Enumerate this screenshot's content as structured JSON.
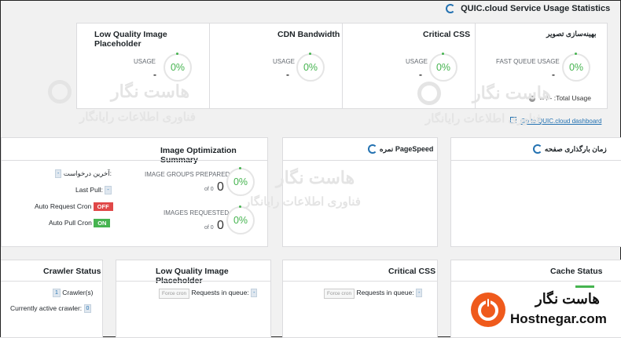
{
  "header": {
    "title": "QUIC.cloud Service Usage Statistics"
  },
  "usage_cards": [
    {
      "title": "Low Quality Image Placeholder",
      "label": "USAGE",
      "value": "-",
      "percent": "0%"
    },
    {
      "title": "CDN Bandwidth",
      "label": "USAGE",
      "value": "-",
      "percent": "0%"
    },
    {
      "title": "Critical CSS",
      "label": "USAGE",
      "value": "-",
      "percent": "0%"
    },
    {
      "title": "بهینه‌سازی تصویر",
      "label": "FAST QUEUE USAGE",
      "value": "-",
      "percent": "0%",
      "total_text": "∞ / - :Total Usage"
    }
  ],
  "dashboard_link": "Go to QUIC.cloud dashboard",
  "image_opt": {
    "title": "Image Optimization Summary",
    "last_request_label": "آخرین درخواست:",
    "last_request_value": "-",
    "last_pull_label": "Last Pull:",
    "last_pull_value": "-",
    "auto_request_label": "Auto Request Cron",
    "auto_request_state": "OFF",
    "auto_pull_label": "Auto Pull Cron",
    "auto_pull_state": "ON",
    "groups_label": "IMAGE GROUPS PREPARED",
    "groups_of": "of 0",
    "groups_value": "0",
    "groups_percent": "0%",
    "requested_label": "IMAGES REQUESTED",
    "requested_of": "of 0",
    "requested_value": "0",
    "requested_percent": "0%"
  },
  "pagespeed": {
    "title": "نمره PageSpeed"
  },
  "load_time": {
    "title": "زمان بارگذاری صفحه"
  },
  "crawler": {
    "title": "Crawler Status",
    "crawlers_label": "Crawler(s)",
    "crawlers_value": "1",
    "active_label": "Currently active crawler:",
    "active_value": "0"
  },
  "lqip_queue": {
    "title": "Low Quality Image Placeholder",
    "button": "Force cron",
    "queue_label": "Requests in queue:",
    "queue_value": "-"
  },
  "ccss_queue": {
    "title": "Critical CSS",
    "button": "Force cron",
    "queue_label": "Requests in queue:",
    "queue_value": "-"
  },
  "cache": {
    "title": "Cache Status"
  },
  "watermark": {
    "brand_fa": "هاست نگار",
    "sub_fa": "فناوری اطلاعات رایانگار"
  },
  "logo": {
    "name_fa": "هاست نگار",
    "name_en": "Hostnegar.com"
  },
  "colors": {
    "accent": "#2271b1",
    "ok": "#46b450",
    "off": "#e04848",
    "logo": "#ef5a1c"
  }
}
